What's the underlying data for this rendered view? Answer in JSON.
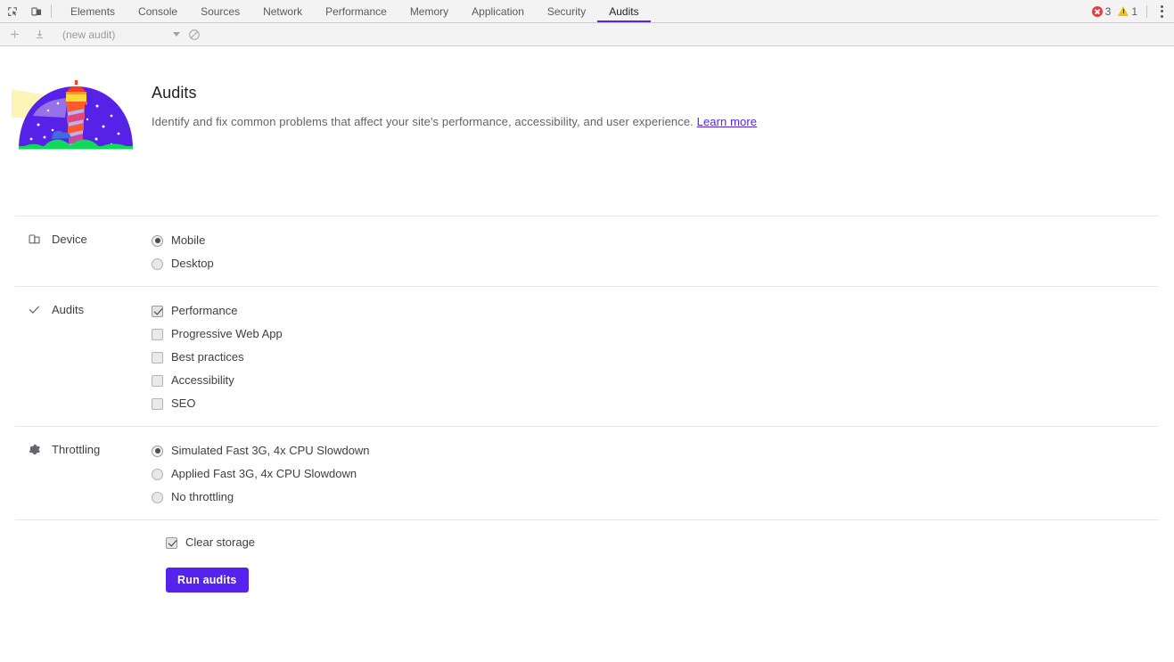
{
  "devtools": {
    "left_icons": [
      {
        "name": "inspect-element-icon",
        "title": "Inspect element"
      },
      {
        "name": "device-toolbar-icon",
        "title": "Toggle device toolbar"
      }
    ],
    "tabs": [
      {
        "label": "Elements",
        "active": false
      },
      {
        "label": "Console",
        "active": false
      },
      {
        "label": "Sources",
        "active": false
      },
      {
        "label": "Network",
        "active": false
      },
      {
        "label": "Performance",
        "active": false
      },
      {
        "label": "Memory",
        "active": false
      },
      {
        "label": "Application",
        "active": false
      },
      {
        "label": "Security",
        "active": false
      },
      {
        "label": "Audits",
        "active": true
      }
    ],
    "status": {
      "error_icon": "error-circle-icon",
      "error_count": "3",
      "warning_icon": "warning-triangle-icon",
      "warning_count": "1",
      "menu_icon": "more-options-icon"
    },
    "accent_color": "#5522ee"
  },
  "panel_toolbar": {
    "add_icon": "add-icon",
    "import_icon": "import-icon",
    "audit_select_value": "(new audit)",
    "chevron_icon": "chevron-down-icon",
    "clear_icon": "clear-all-icon"
  },
  "hero": {
    "logo_name": "lighthouse-logo",
    "title": "Audits",
    "description": "Identify and fix common problems that affect your site's performance, accessibility, and user experience.",
    "link_label": "Learn more",
    "link_color": "#5522ee"
  },
  "sections": [
    {
      "id": "device",
      "icon": "device-icon",
      "label": "Device",
      "control": "radio",
      "options": [
        {
          "label": "Mobile",
          "checked": true
        },
        {
          "label": "Desktop",
          "checked": false
        }
      ]
    },
    {
      "id": "audits",
      "icon": "checkmark-icon",
      "label": "Audits",
      "control": "checkbox",
      "options": [
        {
          "label": "Performance",
          "checked": true
        },
        {
          "label": "Progressive Web App",
          "checked": false
        },
        {
          "label": "Best practices",
          "checked": false
        },
        {
          "label": "Accessibility",
          "checked": false
        },
        {
          "label": "SEO",
          "checked": false
        }
      ]
    },
    {
      "id": "throttling",
      "icon": "gear-icon",
      "label": "Throttling",
      "control": "radio",
      "options": [
        {
          "label": "Simulated Fast 3G, 4x CPU Slowdown",
          "checked": true
        },
        {
          "label": "Applied Fast 3G, 4x CPU Slowdown",
          "checked": false
        },
        {
          "label": "No throttling",
          "checked": false
        }
      ]
    }
  ],
  "footer": {
    "clear_storage": {
      "label": "Clear storage",
      "checked": true
    },
    "run_button_label": "Run audits",
    "run_button_color": "#5522ee"
  }
}
